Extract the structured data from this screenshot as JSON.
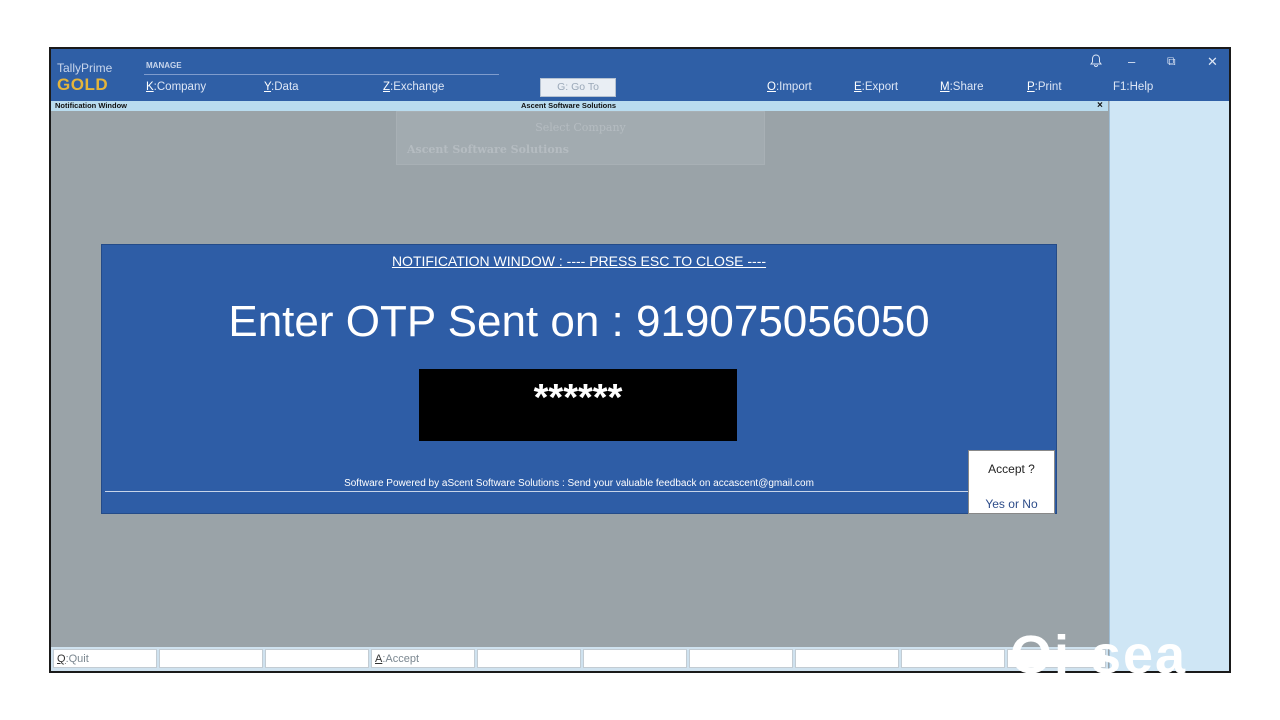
{
  "brand": {
    "product": "TallyPrime",
    "edition": "GOLD"
  },
  "menu": {
    "section_label": "MANAGE",
    "items": [
      {
        "key": "K",
        "label": "Company"
      },
      {
        "key": "Y",
        "label": "Data"
      },
      {
        "key": "Z",
        "label": "Exchange"
      },
      {
        "key": "G",
        "label": "Go To"
      },
      {
        "key": "O",
        "label": "Import"
      },
      {
        "key": "E",
        "label": "Export"
      },
      {
        "key": "M",
        "label": "Share"
      },
      {
        "key": "P",
        "label": "Print"
      },
      {
        "key": "F1",
        "label": "Help"
      }
    ]
  },
  "window_controls": {
    "bell": "🔔",
    "minimize": "–",
    "restore": "⧉",
    "close": "✕"
  },
  "subbar": {
    "left_title": "Notification Window",
    "center_title": "Ascent Software Solutions",
    "close": "×"
  },
  "select_company": {
    "title": "Select Company",
    "company": "Ascent Software Solutions"
  },
  "notification": {
    "header": "NOTIFICATION WINDOW : ----   PRESS ESC TO CLOSE ----",
    "prompt": "Enter OTP Sent on : 919075056050",
    "otp_masked": "******",
    "footer": "Software Powered by aScent Software Solutions : Send your valuable feedback on accascent@gmail.com"
  },
  "accept_dialog": {
    "question": "Accept ?",
    "yes": "Yes",
    "or": "or",
    "no": "No"
  },
  "bottom_bar": [
    {
      "key": "Q",
      "label": "Quit"
    },
    {
      "key": "A",
      "label": "Accept"
    }
  ],
  "watermark": "Oi-sea"
}
